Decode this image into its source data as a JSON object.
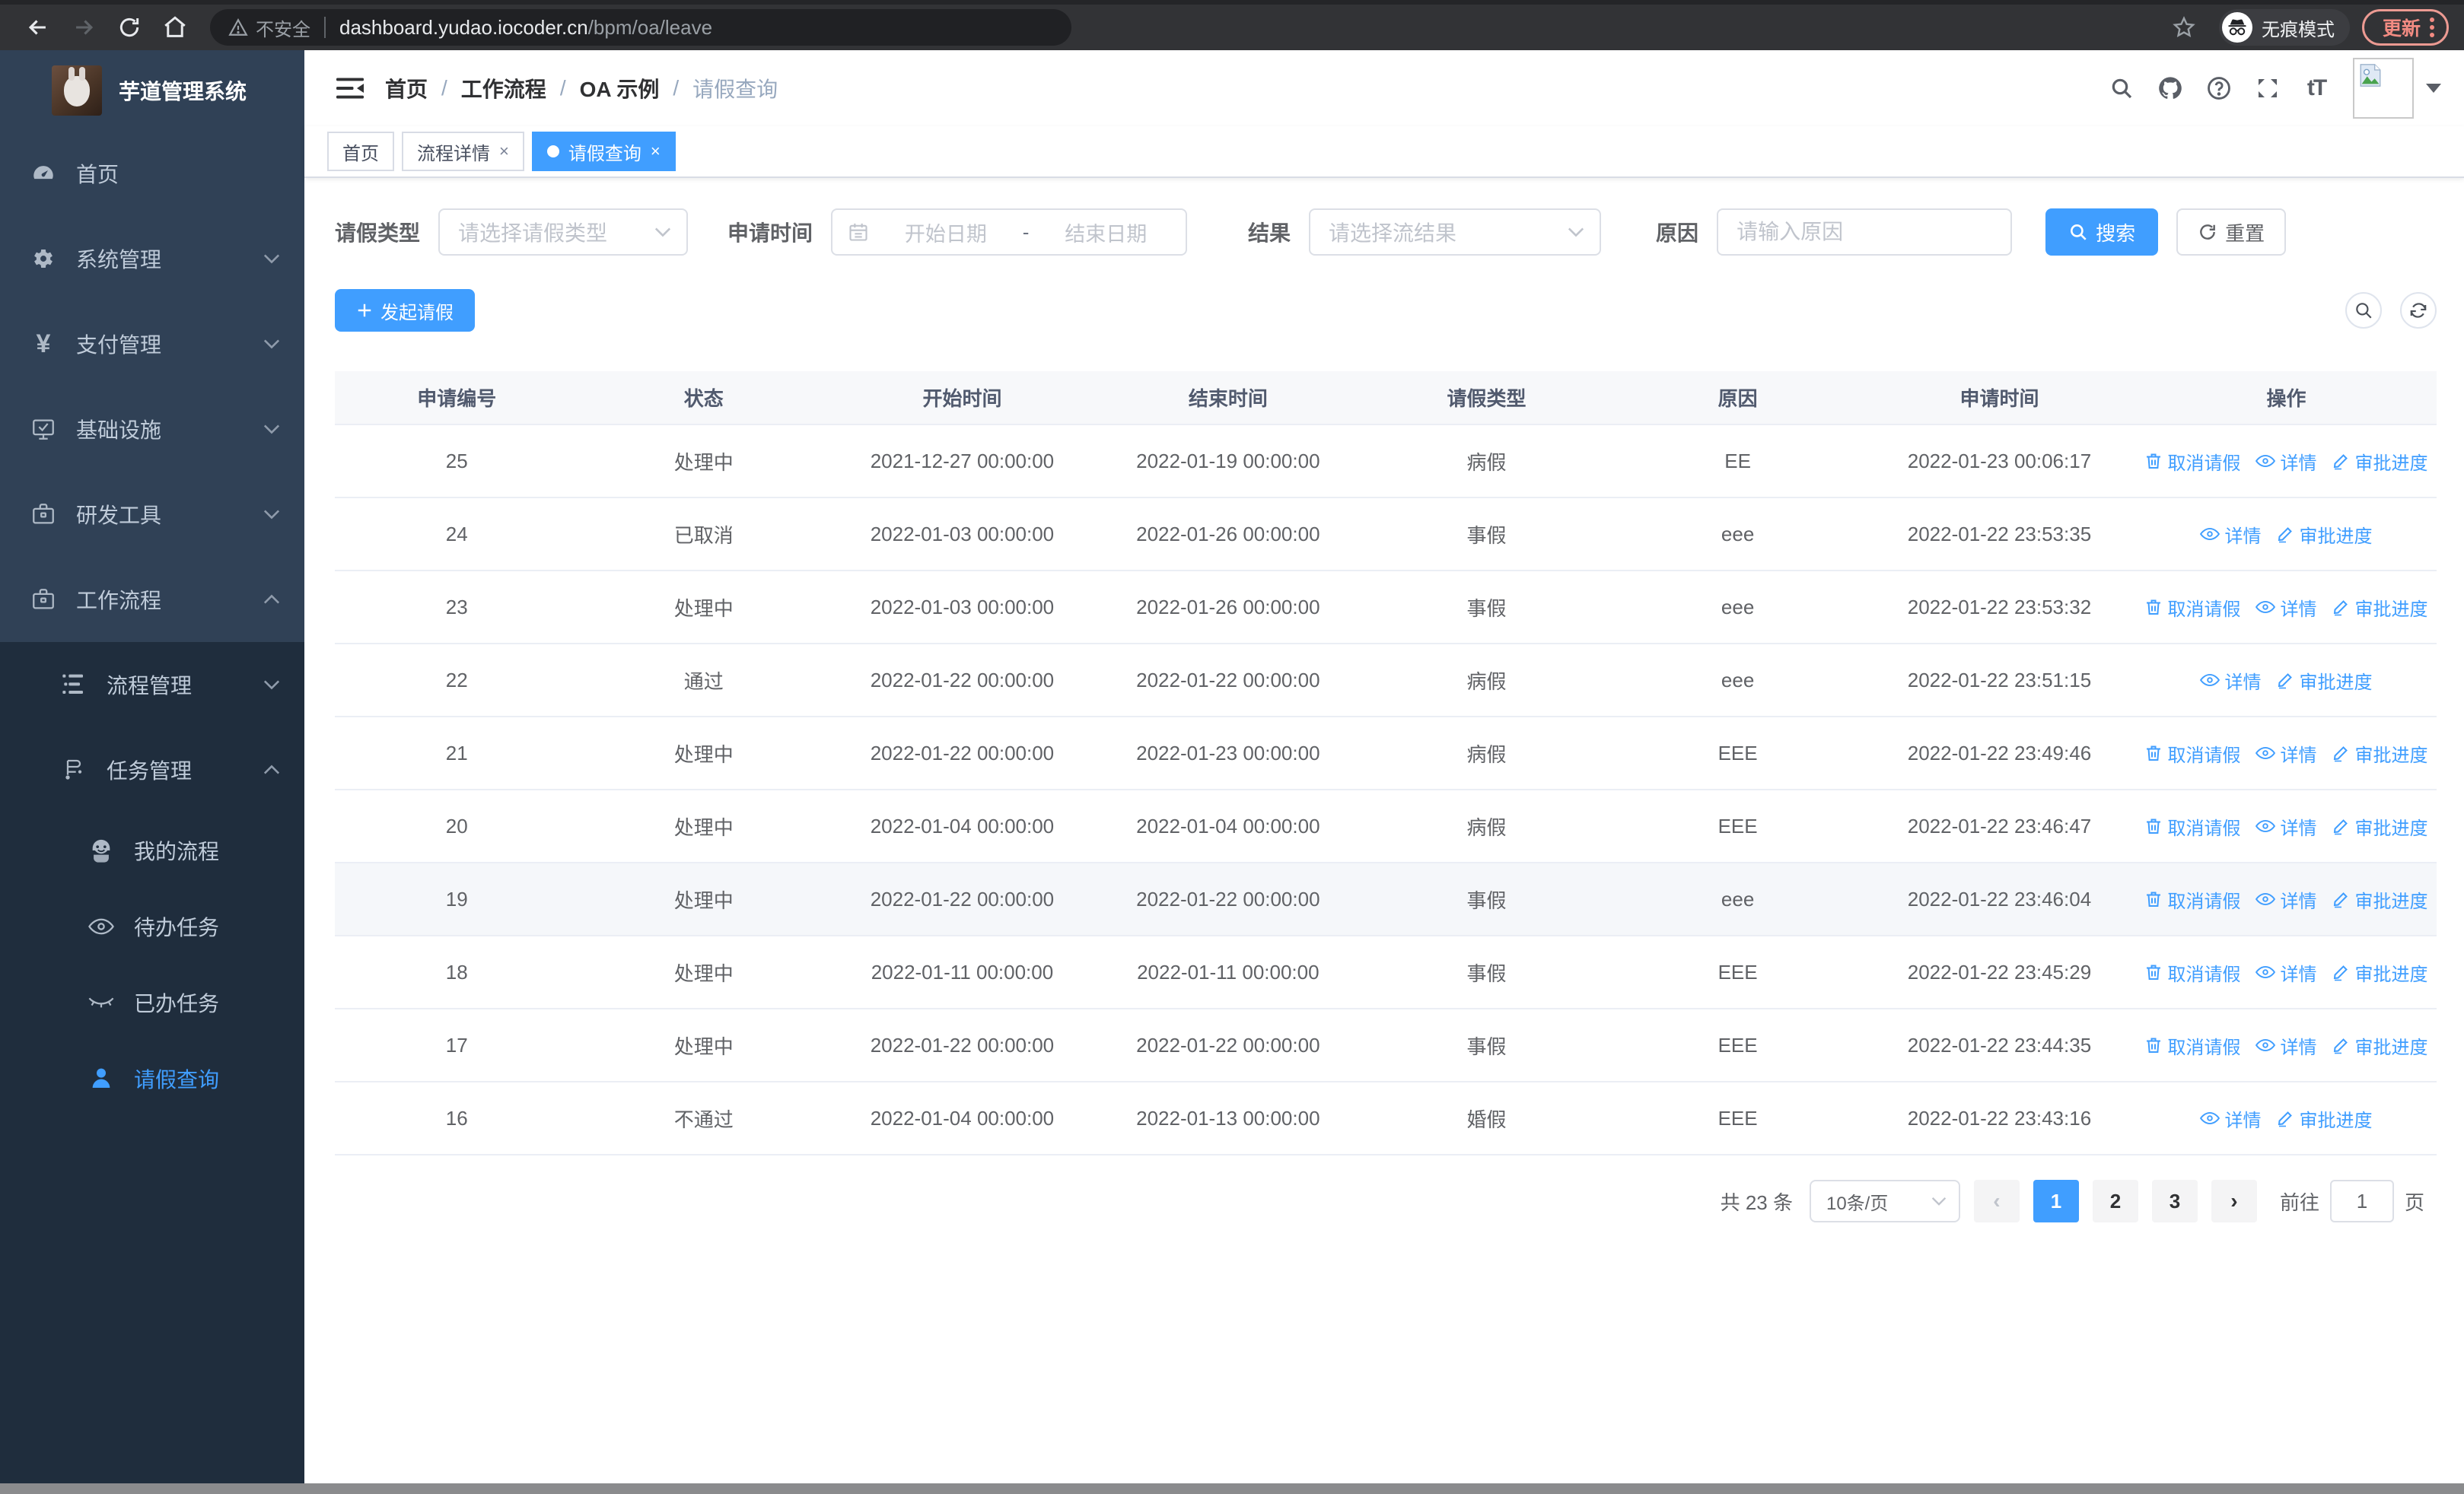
{
  "browser": {
    "security_label": "不安全",
    "url_host": "dashboard.yudao.iocoder.cn",
    "url_path": "/bpm/oa/leave",
    "incognito_label": "无痕模式",
    "update_label": "更新"
  },
  "sidebar": {
    "logo_title": "芋道管理系统",
    "items": [
      {
        "label": "首页"
      },
      {
        "label": "系统管理"
      },
      {
        "label": "支付管理"
      },
      {
        "label": "基础设施"
      },
      {
        "label": "研发工具"
      },
      {
        "label": "工作流程"
      }
    ],
    "submenu": [
      {
        "label": "流程管理"
      },
      {
        "label": "任务管理"
      }
    ],
    "nested": [
      {
        "label": "我的流程"
      },
      {
        "label": "待办任务"
      },
      {
        "label": "已办任务"
      },
      {
        "label": "请假查询"
      }
    ]
  },
  "header": {
    "breadcrumb": [
      "首页",
      "工作流程",
      "OA 示例",
      "请假查询"
    ],
    "separator": "/"
  },
  "tabs": [
    {
      "label": "首页"
    },
    {
      "label": "流程详情"
    },
    {
      "label": "请假查询"
    }
  ],
  "filters": {
    "leave_type_label": "请假类型",
    "leave_type_placeholder": "请选择请假类型",
    "apply_time_label": "申请时间",
    "start_date_placeholder": "开始日期",
    "range_separator": "-",
    "end_date_placeholder": "结束日期",
    "result_label": "结果",
    "result_placeholder": "请选择流结果",
    "reason_label": "原因",
    "reason_placeholder": "请输入原因",
    "search_label": "搜索",
    "reset_label": "重置"
  },
  "toolbar": {
    "create_label": "发起请假"
  },
  "table": {
    "columns": [
      "申请编号",
      "状态",
      "开始时间",
      "结束时间",
      "请假类型",
      "原因",
      "申请时间",
      "操作"
    ],
    "action_labels": {
      "cancel": "取消请假",
      "detail": "详情",
      "progress": "审批进度"
    },
    "rows": [
      {
        "id": "25",
        "status": "处理中",
        "start": "2021-12-27 00:00:00",
        "end": "2022-01-19 00:00:00",
        "type": "病假",
        "reason": "EE",
        "applied": "2022-01-23 00:06:17",
        "cancelable": true,
        "hover": false
      },
      {
        "id": "24",
        "status": "已取消",
        "start": "2022-01-03 00:00:00",
        "end": "2022-01-26 00:00:00",
        "type": "事假",
        "reason": "eee",
        "applied": "2022-01-22 23:53:35",
        "cancelable": false,
        "hover": false
      },
      {
        "id": "23",
        "status": "处理中",
        "start": "2022-01-03 00:00:00",
        "end": "2022-01-26 00:00:00",
        "type": "事假",
        "reason": "eee",
        "applied": "2022-01-22 23:53:32",
        "cancelable": true,
        "hover": false
      },
      {
        "id": "22",
        "status": "通过",
        "start": "2022-01-22 00:00:00",
        "end": "2022-01-22 00:00:00",
        "type": "病假",
        "reason": "eee",
        "applied": "2022-01-22 23:51:15",
        "cancelable": false,
        "hover": false
      },
      {
        "id": "21",
        "status": "处理中",
        "start": "2022-01-22 00:00:00",
        "end": "2022-01-23 00:00:00",
        "type": "病假",
        "reason": "EEE",
        "applied": "2022-01-22 23:49:46",
        "cancelable": true,
        "hover": false
      },
      {
        "id": "20",
        "status": "处理中",
        "start": "2022-01-04 00:00:00",
        "end": "2022-01-04 00:00:00",
        "type": "病假",
        "reason": "EEE",
        "applied": "2022-01-22 23:46:47",
        "cancelable": true,
        "hover": false
      },
      {
        "id": "19",
        "status": "处理中",
        "start": "2022-01-22 00:00:00",
        "end": "2022-01-22 00:00:00",
        "type": "事假",
        "reason": "eee",
        "applied": "2022-01-22 23:46:04",
        "cancelable": true,
        "hover": true
      },
      {
        "id": "18",
        "status": "处理中",
        "start": "2022-01-11 00:00:00",
        "end": "2022-01-11 00:00:00",
        "type": "事假",
        "reason": "EEE",
        "applied": "2022-01-22 23:45:29",
        "cancelable": true,
        "hover": false
      },
      {
        "id": "17",
        "status": "处理中",
        "start": "2022-01-22 00:00:00",
        "end": "2022-01-22 00:00:00",
        "type": "事假",
        "reason": "EEE",
        "applied": "2022-01-22 23:44:35",
        "cancelable": true,
        "hover": false
      },
      {
        "id": "16",
        "status": "不通过",
        "start": "2022-01-04 00:00:00",
        "end": "2022-01-13 00:00:00",
        "type": "婚假",
        "reason": "EEE",
        "applied": "2022-01-22 23:43:16",
        "cancelable": false,
        "hover": false
      }
    ]
  },
  "pagination": {
    "total_label": "共 23 条",
    "page_size_value": "10条/页",
    "pages": [
      "1",
      "2",
      "3"
    ],
    "active_page": "1",
    "goto_label": "前往",
    "goto_value": "1",
    "page_unit_label": "页"
  }
}
